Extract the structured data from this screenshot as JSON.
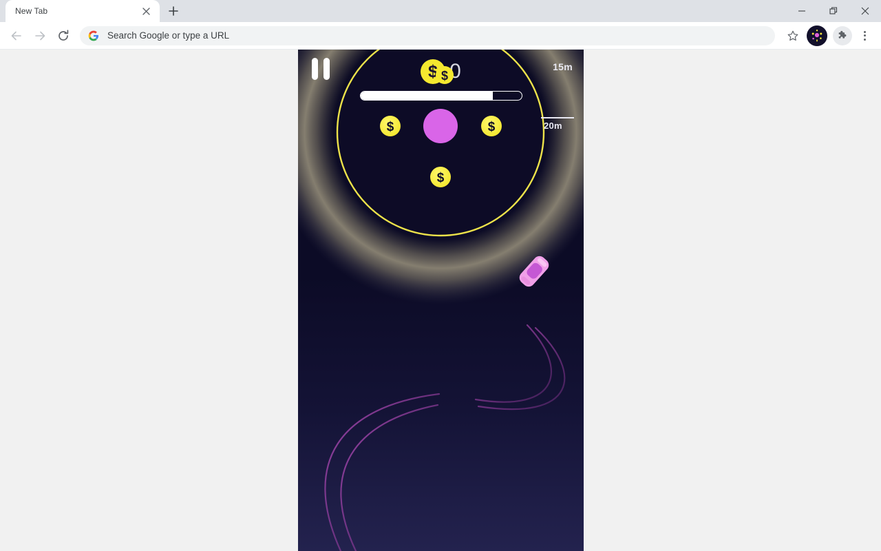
{
  "browser": {
    "tab": {
      "title": "New Tab",
      "close_icon": "close-icon"
    },
    "new_tab_icon": "plus-icon",
    "window_controls": {
      "minimize_icon": "minimize-icon",
      "maximize_icon": "restore-icon",
      "close_icon": "close-icon"
    },
    "toolbar": {
      "back_icon": "arrow-left-icon",
      "forward_icon": "arrow-right-icon",
      "reload_icon": "reload-icon",
      "search_engine_icon": "google-g-icon",
      "omnibox_placeholder": "Search Google or type a URL",
      "omnibox_value": "",
      "bookmark_icon": "star-icon",
      "profile_icon": "profile-avatar-icon",
      "extensions_icon": "puzzle-piece-icon",
      "menu_icon": "three-dot-menu-icon"
    }
  },
  "game": {
    "name": "drift-racing-game",
    "pause_icon": "pause-icon",
    "coin_icon": "dollar-coin-icon",
    "coin_count": "0",
    "progress_percent": 82,
    "distance_markers": [
      {
        "label": "15m",
        "name": "distance-marker-15m"
      },
      {
        "label": "20m",
        "name": "distance-marker-20m"
      }
    ],
    "target_ring": {
      "name": "target-ring",
      "stroke_color": "#ece24a",
      "glow_color": "#b9b2a0"
    },
    "player_target": {
      "name": "target-circle",
      "color": "#d965e8"
    },
    "pickup_coins": [
      {
        "name": "pickup-coin-left"
      },
      {
        "name": "pickup-coin-right"
      },
      {
        "name": "pickup-coin-bottom"
      }
    ],
    "car": {
      "name": "player-car",
      "color": "#f0a0e8"
    },
    "tire_trails": {
      "name": "tire-trail",
      "color": "#a03ca8"
    },
    "background_colors": {
      "top": "#0c0b24",
      "bottom": "#23224e"
    }
  }
}
